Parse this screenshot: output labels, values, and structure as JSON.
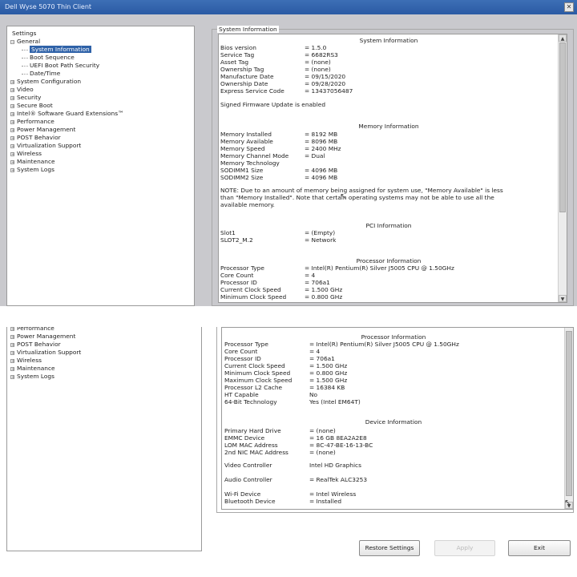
{
  "window_title": "Dell Wyse 5070 Thin Client",
  "close_glyph": "✕",
  "tree": {
    "root": "Settings",
    "general": "General",
    "general_children": [
      "System Information",
      "Boot Sequence",
      "UEFI Boot Path Security",
      "Date/Time"
    ],
    "items": [
      "System Configuration",
      "Video",
      "Security",
      "Secure Boot",
      "Intel® Software Guard Extensions™",
      "Performance",
      "Power Management",
      "POST Behavior",
      "Virtualization Support",
      "Wireless",
      "Maintenance",
      "System Logs"
    ],
    "lower_items": [
      "Performance",
      "Power Management",
      "POST Behavior",
      "Virtualization Support",
      "Wireless",
      "Maintenance",
      "System Logs"
    ]
  },
  "group_title": "System Information",
  "sections": {
    "system": {
      "title": "System Information",
      "rows": [
        {
          "k": "Bios version",
          "v": "= 1.5.0"
        },
        {
          "k": "Service Tag",
          "v": "= 6682RS3"
        },
        {
          "k": "Asset Tag",
          "v": "= (none)"
        },
        {
          "k": "Ownership Tag",
          "v": "= (none)"
        },
        {
          "k": "Manufacture Date",
          "v": "= 09/15/2020"
        },
        {
          "k": "Ownership Date",
          "v": "= 09/28/2020"
        },
        {
          "k": "Express Service Code",
          "v": "= 13437056487"
        }
      ],
      "note": "Signed Firmware Update is enabled"
    },
    "memory": {
      "title": "Memory Information",
      "rows": [
        {
          "k": "Memory Installed",
          "v": "= 8192 MB"
        },
        {
          "k": "Memory Available",
          "v": "= 8096 MB"
        },
        {
          "k": "Memory Speed",
          "v": "= 2400 MHz"
        },
        {
          "k": "Memory Channel Mode",
          "v": "= Dual"
        },
        {
          "k": "Memory Technology",
          "v": ""
        },
        {
          "k": "SODIMM1 Size",
          "v": "= 4096 MB"
        },
        {
          "k": "SODIMM2 Size",
          "v": "= 4096 MB"
        }
      ],
      "note_lines": [
        "NOTE: Due to an amount of memory being assigned for system use, \"Memory Available\" is less",
        "than \"Memory Installed\". Note that certain operating systems may not be able to use all the",
        "available memory."
      ]
    },
    "pci": {
      "title": "PCI Information",
      "rows": [
        {
          "k": "Slot1",
          "v": "= (Empty)"
        },
        {
          "k": "SLOT2_M.2",
          "v": "= Network"
        }
      ]
    },
    "processor": {
      "title": "Processor Information",
      "rows": [
        {
          "k": "Processor Type",
          "v": "= Intel(R) Pentium(R) Silver J5005 CPU @ 1.50GHz"
        },
        {
          "k": "Core Count",
          "v": "= 4"
        },
        {
          "k": "Processor ID",
          "v": "= 706a1"
        },
        {
          "k": "Current Clock Speed",
          "v": "= 1.500 GHz"
        },
        {
          "k": "Minimum Clock Speed",
          "v": "= 0.800 GHz"
        },
        {
          "k": "Maximum Clock Speed",
          "v": "= 1.500 GHz"
        },
        {
          "k": "Processor L2 Cache",
          "v": "= 16384 KB"
        },
        {
          "k": "HT Capable",
          "v": "No"
        },
        {
          "k": "64-Bit Technology",
          "v": "Yes (Intel EM64T)"
        }
      ]
    },
    "device": {
      "title": "Device Information",
      "rows": [
        {
          "k": "Primary Hard Drive",
          "v": "= (none)"
        },
        {
          "k": "EMMC Device",
          "v": "= 16 GB 8EA2A2E8"
        },
        {
          "k": "LOM MAC Address",
          "v": "= 8C-47-BE-16-13-BC"
        },
        {
          "k": "2nd NIC MAC Address",
          "v": "= (none)"
        }
      ],
      "video": {
        "k": "Video Controller",
        "v": "Intel HD Graphics"
      },
      "audio": {
        "k": "Audio Controller",
        "v": "= RealTek ALC3253"
      },
      "wifi": {
        "k": "Wi-Fi Device",
        "v": "= Intel Wireless"
      },
      "bt": {
        "k": "Bluetooth Device",
        "v": "= Installed"
      }
    }
  },
  "buttons": {
    "restore": "Restore Settings",
    "apply": "Apply",
    "exit": "Exit"
  },
  "scroll": {
    "top_position": 0.0,
    "bottom_position": 1.0
  },
  "colors": {
    "titlebar": "#2a5aa4",
    "selection": "#2f62a8"
  }
}
